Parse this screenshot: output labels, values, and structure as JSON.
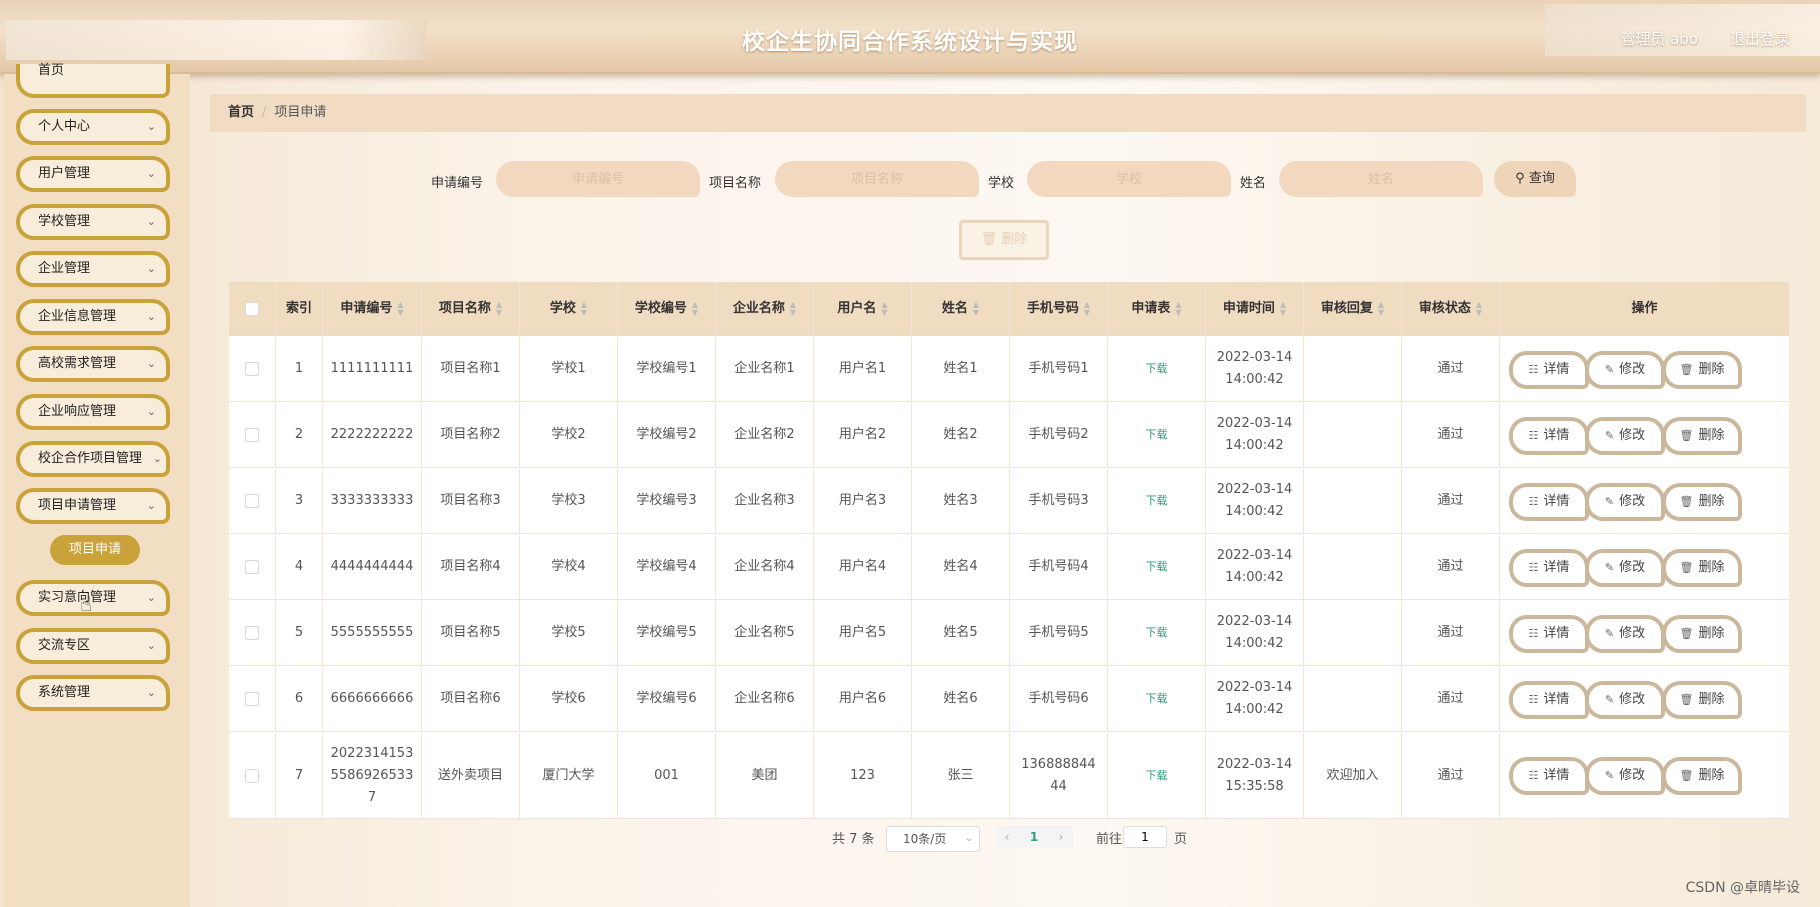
{
  "header": {
    "title": "校企生协同合作系统设计与实现",
    "user": "管理员 abo",
    "logout": "退出登录"
  },
  "sidebar": {
    "items": [
      {
        "label": "首页"
      },
      {
        "label": "个人中心"
      },
      {
        "label": "用户管理"
      },
      {
        "label": "学校管理"
      },
      {
        "label": "企业管理"
      },
      {
        "label": "企业信息管理"
      },
      {
        "label": "高校需求管理"
      },
      {
        "label": "企业响应管理"
      },
      {
        "label": "校企合作项目管理"
      },
      {
        "label": "项目申请管理"
      },
      {
        "label": "实习意向管理"
      },
      {
        "label": "交流专区"
      },
      {
        "label": "系统管理"
      }
    ],
    "active_sub": "项目申请"
  },
  "breadcrumb": {
    "home": "首页",
    "sep": "/",
    "current": "项目申请"
  },
  "search": {
    "apply_no_label": "申请编号",
    "apply_no_placeholder": "申请编号",
    "project_label": "项目名称",
    "project_placeholder": "项目名称",
    "school_label": "学校",
    "school_placeholder": "学校",
    "name_label": "姓名",
    "name_placeholder": "姓名",
    "query": "查询",
    "delete": "删除"
  },
  "table": {
    "headers": [
      "索引",
      "申请编号",
      "项目名称",
      "学校",
      "学校编号",
      "企业名称",
      "用户名",
      "姓名",
      "手机号码",
      "申请表",
      "申请时间",
      "审核回复",
      "审核状态",
      "操作"
    ],
    "rows": [
      {
        "idx": "1",
        "no": "1111111111",
        "project": "项目名称1",
        "school": "学校1",
        "school_no": "学校编号1",
        "company": "企业名称1",
        "user": "用户名1",
        "name": "姓名1",
        "phone": "手机号码1",
        "form": "下载",
        "date": "2022-03-14",
        "time": "14:00:42",
        "reply": "",
        "status": "通过"
      },
      {
        "idx": "2",
        "no": "2222222222",
        "project": "项目名称2",
        "school": "学校2",
        "school_no": "学校编号2",
        "company": "企业名称2",
        "user": "用户名2",
        "name": "姓名2",
        "phone": "手机号码2",
        "form": "下载",
        "date": "2022-03-14",
        "time": "14:00:42",
        "reply": "",
        "status": "通过"
      },
      {
        "idx": "3",
        "no": "3333333333",
        "project": "项目名称3",
        "school": "学校3",
        "school_no": "学校编号3",
        "company": "企业名称3",
        "user": "用户名3",
        "name": "姓名3",
        "phone": "手机号码3",
        "form": "下载",
        "date": "2022-03-14",
        "time": "14:00:42",
        "reply": "",
        "status": "通过"
      },
      {
        "idx": "4",
        "no": "4444444444",
        "project": "项目名称4",
        "school": "学校4",
        "school_no": "学校编号4",
        "company": "企业名称4",
        "user": "用户名4",
        "name": "姓名4",
        "phone": "手机号码4",
        "form": "下载",
        "date": "2022-03-14",
        "time": "14:00:42",
        "reply": "",
        "status": "通过"
      },
      {
        "idx": "5",
        "no": "5555555555",
        "project": "项目名称5",
        "school": "学校5",
        "school_no": "学校编号5",
        "company": "企业名称5",
        "user": "用户名5",
        "name": "姓名5",
        "phone": "手机号码5",
        "form": "下载",
        "date": "2022-03-14",
        "time": "14:00:42",
        "reply": "",
        "status": "通过"
      },
      {
        "idx": "6",
        "no": "6666666666",
        "project": "项目名称6",
        "school": "学校6",
        "school_no": "学校编号6",
        "company": "企业名称6",
        "user": "用户名6",
        "name": "姓名6",
        "phone": "手机号码6",
        "form": "下载",
        "date": "2022-03-14",
        "time": "14:00:42",
        "reply": "",
        "status": "通过"
      },
      {
        "idx": "7",
        "no": "20223141535586926533 7",
        "no_lines": [
          "2022314153",
          "5586926533",
          "7"
        ],
        "project": "送外卖项目",
        "school": "厦门大学",
        "school_no": "001",
        "company": "美团",
        "user": "123",
        "name": "张三",
        "phone": "13688884444",
        "phone_lines": [
          "136888844",
          "44"
        ],
        "form": "下载",
        "date": "2022-03-14",
        "time": "15:35:58",
        "reply": "欢迎加入",
        "status": "通过"
      }
    ],
    "actions": {
      "detail": "详情",
      "edit": "修改",
      "delete": "删除"
    }
  },
  "pagination": {
    "total": "共 7 条",
    "page_size": "10条/页",
    "current": "1",
    "goto": "前往",
    "goto_value": "1",
    "page_unit": "页"
  },
  "watermark": "CSDN @卓晴毕设"
}
